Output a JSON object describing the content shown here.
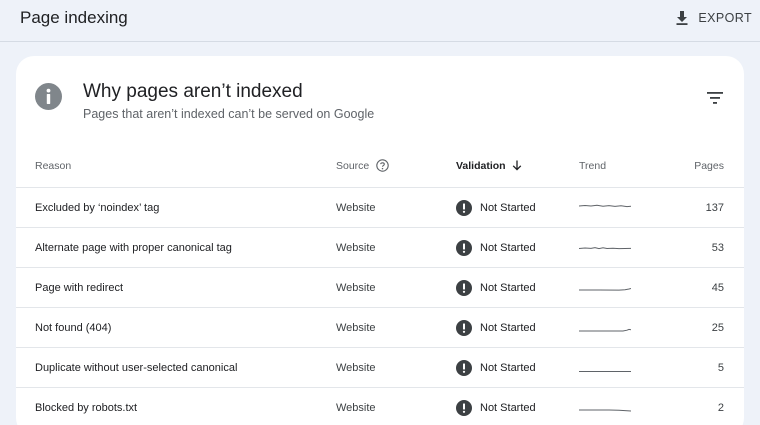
{
  "header": {
    "title": "Page indexing",
    "export_label": "EXPORT"
  },
  "card": {
    "title": "Why pages aren’t indexed",
    "subtitle": "Pages that aren’t indexed can’t be served on Google"
  },
  "table": {
    "columns": {
      "reason": "Reason",
      "source": "Source",
      "validation": "Validation",
      "trend": "Trend",
      "pages": "Pages"
    },
    "rows": [
      {
        "reason": "Excluded by ‘noindex’ tag",
        "source": "Website",
        "validation": "Not Started",
        "pages": "137"
      },
      {
        "reason": "Alternate page with proper canonical tag",
        "source": "Website",
        "validation": "Not Started",
        "pages": "53"
      },
      {
        "reason": "Page with redirect",
        "source": "Website",
        "validation": "Not Started",
        "pages": "45"
      },
      {
        "reason": "Not found (404)",
        "source": "Website",
        "validation": "Not Started",
        "pages": "25"
      },
      {
        "reason": "Duplicate without user-selected canonical",
        "source": "Website",
        "validation": "Not Started",
        "pages": "5"
      },
      {
        "reason": "Blocked by robots.txt",
        "source": "Website",
        "validation": "Not Started",
        "pages": "2"
      }
    ]
  },
  "icons": {
    "export": "download-icon",
    "info": "info-icon",
    "filter": "filter-icon",
    "help": "help-icon",
    "sort": "arrow-down-icon",
    "status": "exclamation-circle-icon"
  },
  "colors": {
    "background": "#eef2f9",
    "card": "#ffffff",
    "info_icon": "#80868b",
    "status_icon": "#3c4043",
    "sparkline": "#5f6368"
  }
}
